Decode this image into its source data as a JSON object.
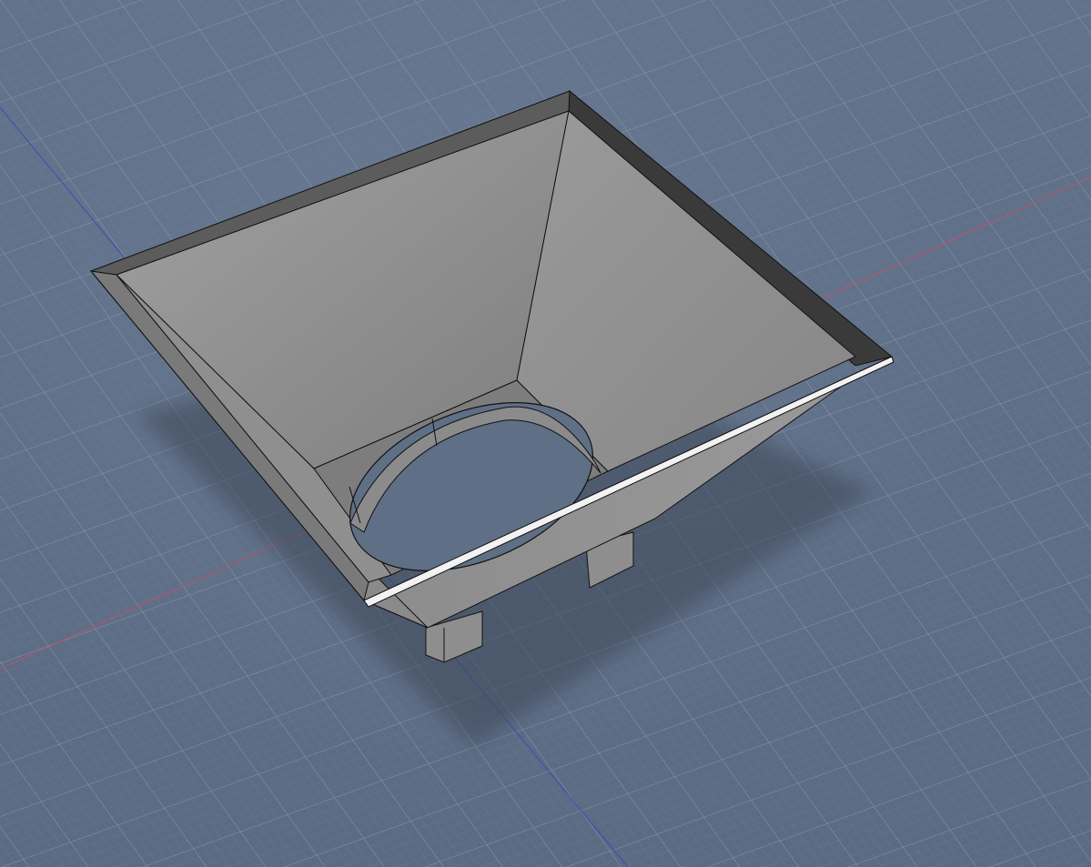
{
  "viewport": {
    "background_color": "#5f6f86",
    "grid_minor_color": "#7e8ca3",
    "grid_major_color": "#95a2b6",
    "x_axis_color": "#c0506a",
    "y_axis_color": "#3a4fb0"
  },
  "model": {
    "body_color": "#8a8a8a",
    "inner_light_color": "#9c9c9c",
    "rim_dark_color": "#3a3a3a",
    "edge_color": "#111111",
    "shadow_color": "#3e4656",
    "leg_count": 4
  }
}
